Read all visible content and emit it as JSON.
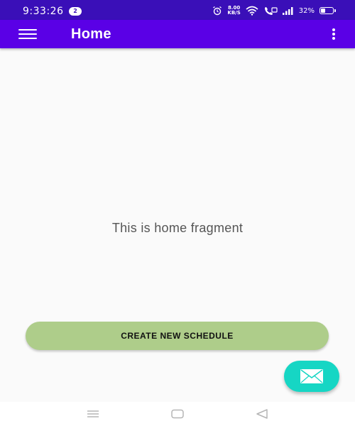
{
  "status_bar": {
    "time": "9:33:26",
    "notification_count": "2",
    "net_speed_value": "8.00",
    "net_speed_unit": "KB/S",
    "battery_percent": "32%",
    "battery_level": 0.32,
    "icons": [
      "alarm-icon",
      "wifi-icon",
      "volte-icon",
      "signal-icon",
      "battery-icon"
    ]
  },
  "app_bar": {
    "title": "Home",
    "menu_icon": "hamburger-menu-icon",
    "overflow_icon": "more-vertical-icon"
  },
  "main": {
    "message": "This is home fragment",
    "create_button_label": "CREATE NEW SCHEDULE",
    "fab_icon": "mail-icon"
  },
  "nav_bar": {
    "icons": [
      "recents-icon",
      "home-icon",
      "back-icon"
    ]
  },
  "colors": {
    "status_bar": "#3a0fb8",
    "app_bar": "#5a00e6",
    "create_button": "#aecd8a",
    "fab": "#16d6c4",
    "background": "#fafafa"
  }
}
